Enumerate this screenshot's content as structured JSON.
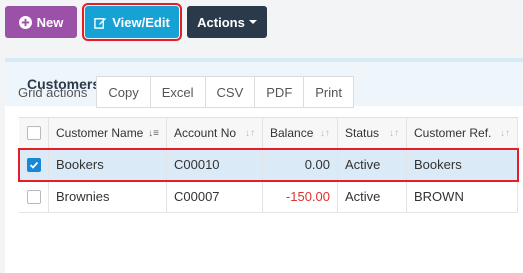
{
  "toolbar": {
    "new_label": "New",
    "view_edit_label": "View/Edit",
    "actions_label": "Actions"
  },
  "panel": {
    "title": "Customers"
  },
  "grid_actions": {
    "label": "Grid actions",
    "buttons": [
      "Copy",
      "Excel",
      "CSV",
      "PDF",
      "Print"
    ]
  },
  "table": {
    "columns": [
      "Customer Name",
      "Account No",
      "Balance",
      "Status",
      "Customer Ref."
    ],
    "rows": [
      {
        "name": "Bookers",
        "account": "C00010",
        "balance": "0.00",
        "status": "Active",
        "ref": "Bookers",
        "selected": true
      },
      {
        "name": "Brownies",
        "account": "C00007",
        "balance": "-150.00",
        "status": "Active",
        "ref": "BROWN",
        "selected": false
      }
    ]
  },
  "colors": {
    "new_button": "#9b51a7",
    "view_button": "#17a2d6",
    "actions_button": "#2b3a4a",
    "highlight": "#e41e26",
    "negative": "#e03131"
  }
}
